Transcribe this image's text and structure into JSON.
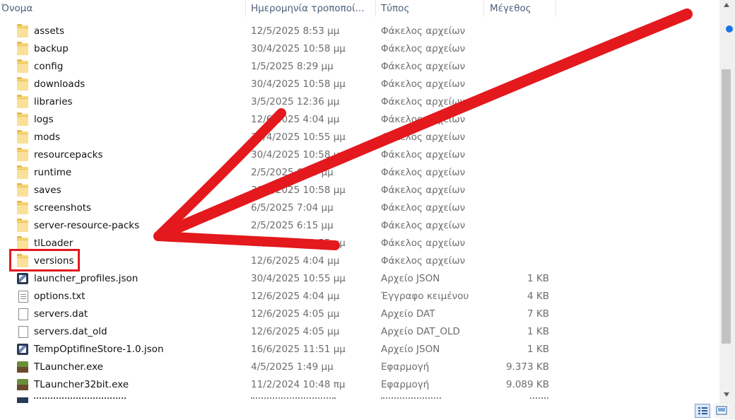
{
  "columns": {
    "name": "Όνομα",
    "date": "Ημερομηνία τροποποί...",
    "type": "Τύπος",
    "size": "Μέγεθος"
  },
  "files": [
    {
      "name": "assets",
      "date": "12/5/2025 8:53 μμ",
      "type": "Φάκελος αρχείων",
      "size": "",
      "icon": "folder-icon"
    },
    {
      "name": "backup",
      "date": "30/4/2025 10:58 μμ",
      "type": "Φάκελος αρχείων",
      "size": "",
      "icon": "folder-icon"
    },
    {
      "name": "config",
      "date": "1/5/2025 8:29 μμ",
      "type": "Φάκελος αρχείων",
      "size": "",
      "icon": "folder-icon"
    },
    {
      "name": "downloads",
      "date": "30/4/2025 10:58 μμ",
      "type": "Φάκελος αρχείων",
      "size": "",
      "icon": "folder-icon"
    },
    {
      "name": "libraries",
      "date": "3/5/2025 12:36 μμ",
      "type": "Φάκελος αρχείων",
      "size": "",
      "icon": "folder-icon"
    },
    {
      "name": "logs",
      "date": "12/6/2025 4:04 μμ",
      "type": "Φάκελος αρχείων",
      "size": "",
      "icon": "folder-icon"
    },
    {
      "name": "mods",
      "date": "30/4/2025 10:55 μμ",
      "type": "Φάκελος αρχείων",
      "size": "",
      "icon": "folder-icon"
    },
    {
      "name": "resourcepacks",
      "date": "30/4/2025 10:58 μμ",
      "type": "Φάκελος αρχείων",
      "size": "",
      "icon": "folder-icon"
    },
    {
      "name": "runtime",
      "date": "2/5/2025 6:00 μμ",
      "type": "Φάκελος αρχείων",
      "size": "",
      "icon": "folder-icon"
    },
    {
      "name": "saves",
      "date": "30/4/2025 10:58 μμ",
      "type": "Φάκελος αρχείων",
      "size": "",
      "icon": "folder-icon"
    },
    {
      "name": "screenshots",
      "date": "6/5/2025 7:04 μμ",
      "type": "Φάκελος αρχείων",
      "size": "",
      "icon": "folder-icon"
    },
    {
      "name": "server-resource-packs",
      "date": "2/5/2025 6:15 μμ",
      "type": "Φάκελος αρχείων",
      "size": "",
      "icon": "folder-icon"
    },
    {
      "name": "tlLoader",
      "date": "30/4/2025 10:55 μμ",
      "type": "Φάκελος αρχείων",
      "size": "",
      "icon": "folder-icon"
    },
    {
      "name": "versions",
      "date": "12/6/2025 4:04 μμ",
      "type": "Φάκελος αρχείων",
      "size": "",
      "icon": "folder-icon"
    },
    {
      "name": "launcher_profiles.json",
      "date": "30/4/2025 10:55 μμ",
      "type": "Αρχείο JSON",
      "size": "1 KB",
      "icon": "json-icon"
    },
    {
      "name": "options.txt",
      "date": "12/6/2025 4:04 μμ",
      "type": "Έγγραφο κειμένου",
      "size": "4 KB",
      "icon": "text-file-icon"
    },
    {
      "name": "servers.dat",
      "date": "12/6/2025 4:05 μμ",
      "type": "Αρχείο DAT",
      "size": "7 KB",
      "icon": "blank-file-icon"
    },
    {
      "name": "servers.dat_old",
      "date": "12/6/2025 4:05 μμ",
      "type": "Αρχείο DAT_OLD",
      "size": "1 KB",
      "icon": "blank-file-icon"
    },
    {
      "name": "TempOptifineStore-1.0.json",
      "date": "16/6/2025 11:51 μμ",
      "type": "Αρχείο JSON",
      "size": "1 KB",
      "icon": "json-icon"
    },
    {
      "name": "TLauncher.exe",
      "date": "4/5/2025 1:49 μμ",
      "type": "Εφαρμογή",
      "size": "9.373 KB",
      "icon": "minecraft-block-icon"
    },
    {
      "name": "TLauncher32bit.exe",
      "date": "11/2/2024 10:48 πμ",
      "type": "Εφαρμογή",
      "size": "9.089 KB",
      "icon": "minecraft-block-icon"
    }
  ],
  "annotation": {
    "arrow_color": "#e3191e",
    "highlight_color": "#e3191e",
    "highlighted_item": "versions"
  }
}
